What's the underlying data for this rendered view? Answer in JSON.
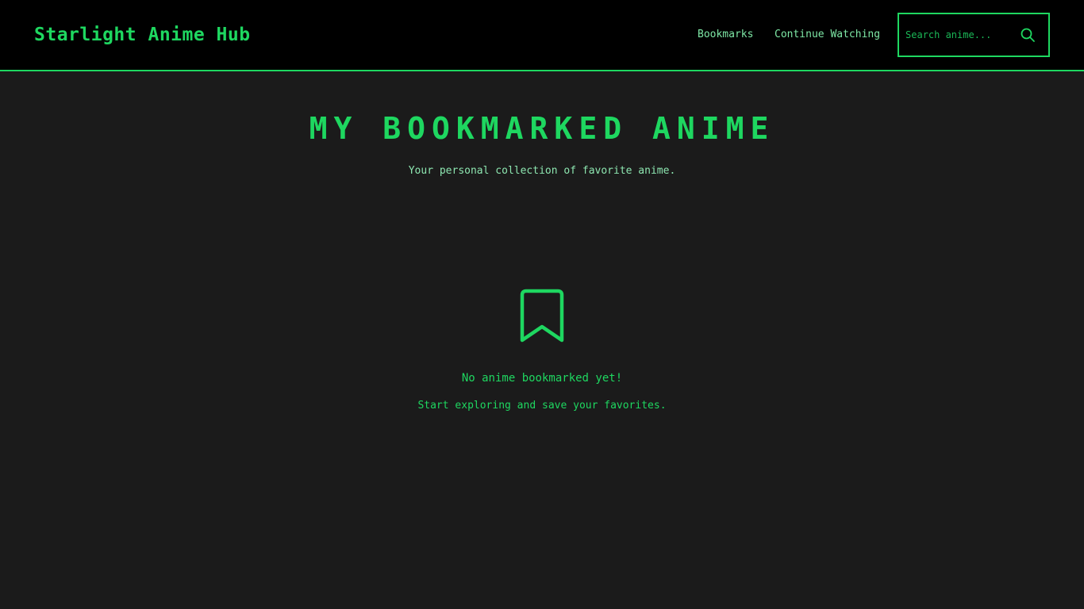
{
  "header": {
    "logo": "Starlight Anime Hub",
    "nav": {
      "bookmarks": "Bookmarks",
      "continue_watching": "Continue Watching"
    },
    "search": {
      "placeholder": "Search anime...",
      "value": "",
      "icon": "search-icon"
    }
  },
  "main": {
    "title": "MY BOOKMARKED ANIME",
    "subtitle": "Your personal collection of favorite anime.",
    "empty_state": {
      "icon": "bookmark-icon",
      "title": "No anime bookmarked yet!",
      "text": "Start exploring and save your favorites."
    }
  },
  "colors": {
    "accent": "#1ed760",
    "header_bg": "#000000",
    "page_bg": "#1b1b1b"
  }
}
